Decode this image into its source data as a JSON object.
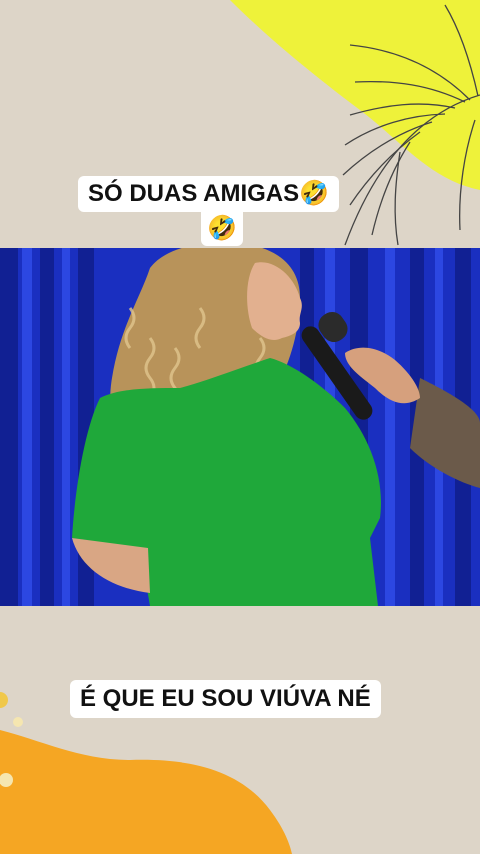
{
  "captions": {
    "top_line1": "SÓ DUAS AMIGAS🤣",
    "top_line2": "🤣",
    "bottom": "É QUE EU SOU VIÚVA NÉ"
  },
  "video": {
    "description": ""
  },
  "colors": {
    "background": "#ddd5c8",
    "accent_yellow": "#eef23a",
    "accent_orange": "#f5a623",
    "curtain_blue": "#1d34c9",
    "shirt_green": "#1fa83a",
    "caption_bg": "#ffffff"
  }
}
